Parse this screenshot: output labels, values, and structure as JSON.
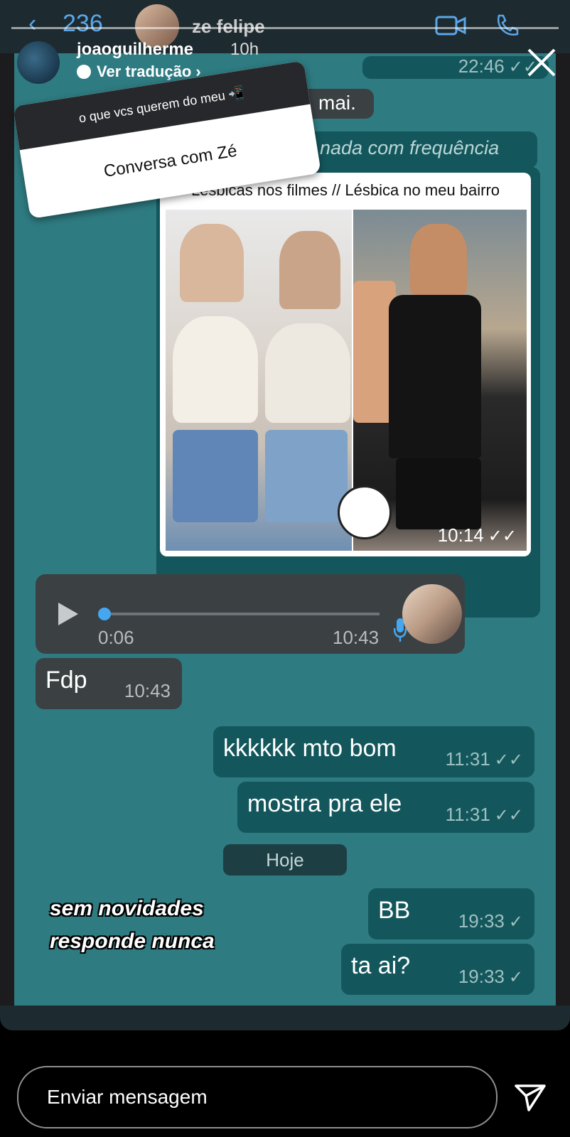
{
  "whatsapp": {
    "back_count": "236",
    "contact_name": "ze felipe",
    "top_time": "22:46",
    "hidden_text_1": "mai.",
    "hidden_text_2": "nada com frequência",
    "image_caption": "Lésbicas nos filmes // Lésbica no meu bairro",
    "image_time": "10:14",
    "audio": {
      "duration": "0:06",
      "time": "10:43"
    },
    "messages": [
      {
        "text": "Fdp",
        "time": "10:43",
        "direction": "in"
      },
      {
        "text": "kkkkkk mto bom",
        "time": "11:31",
        "direction": "out"
      },
      {
        "text": "mostra pra ele",
        "time": "11:31",
        "direction": "out"
      },
      {
        "text": "BB",
        "time": "19:33",
        "direction": "out"
      },
      {
        "text": "ta ai?",
        "time": "19:33",
        "direction": "out"
      }
    ],
    "date_chip": "Hoje"
  },
  "story": {
    "username": "joaoguilherme",
    "posted_ago": "10h",
    "translate_label": "Ver tradução",
    "question_header": "o que vcs querem do meu 📲",
    "question_answer": "Conversa com Zé",
    "sticker_line_1": "sem novidades",
    "sticker_line_2": "responde nunca",
    "reply_placeholder": "Enviar mensagem"
  },
  "colors": {
    "chat_bg": "#2e7b81",
    "outgoing_bubble": "#13575c",
    "incoming_bubble": "#3b4043",
    "accent_blue": "#45a7f0"
  },
  "icons": [
    "back-icon",
    "video-call-icon",
    "phone-icon",
    "close-icon",
    "play-icon",
    "mic-icon",
    "send-icon",
    "double-check-icon",
    "single-check-icon"
  ]
}
